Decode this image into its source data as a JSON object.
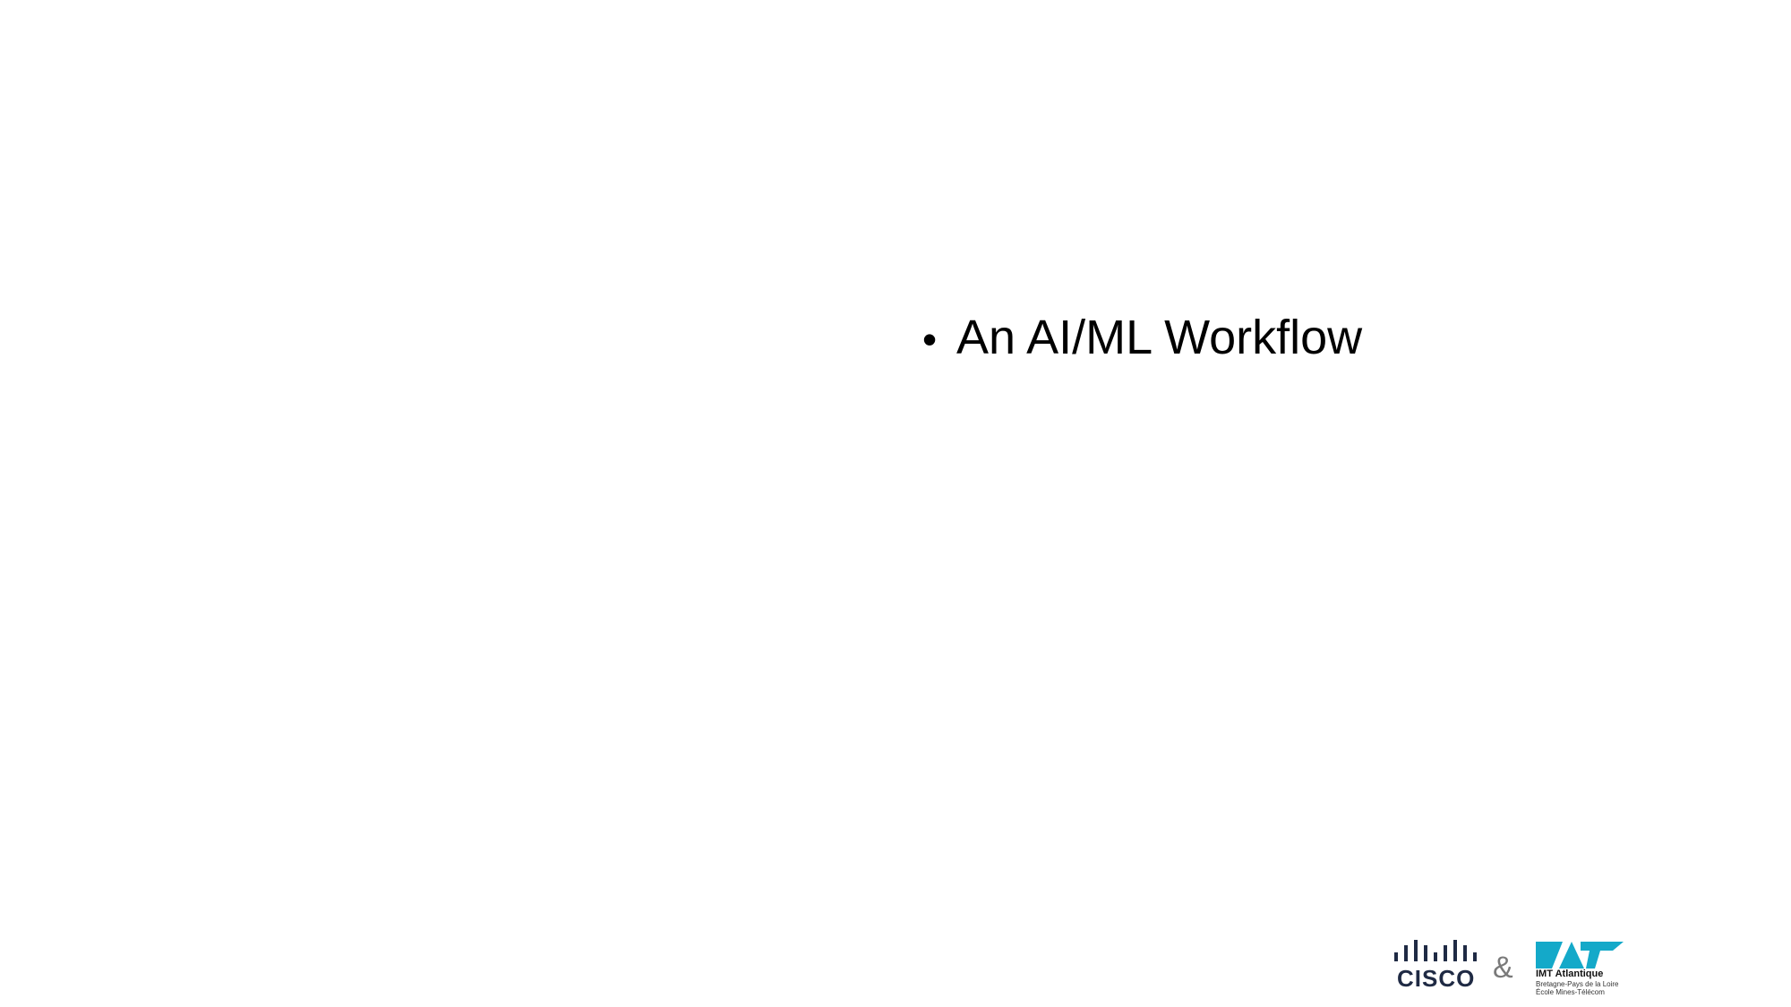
{
  "slide": {
    "bullets": [
      {
        "text": "An AI/ML Workflow"
      }
    ]
  },
  "footer": {
    "cisco_logo": {
      "text": "CISCO",
      "icon": "cisco-logo-icon",
      "color": "#1f2a44"
    },
    "separator": "&",
    "imt_logo": {
      "icon": "imt-atlantique-logo-icon",
      "color": "#14a9c9",
      "name": "IMT Atlantique",
      "line1": "Bretagne-Pays de la Loire",
      "line2": "École Mines-Télécom"
    }
  }
}
